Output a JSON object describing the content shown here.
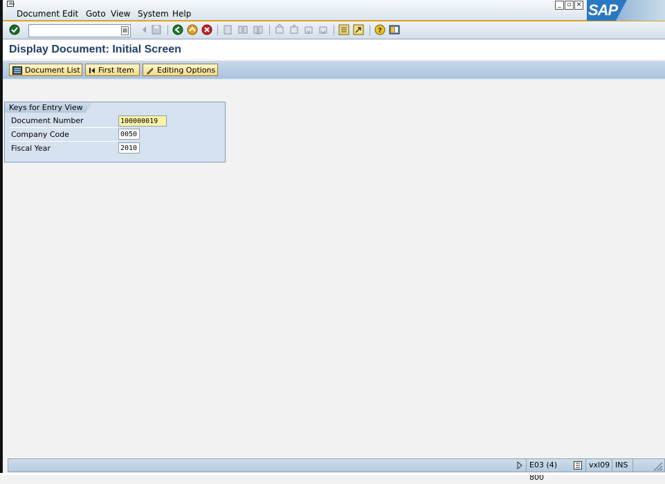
{
  "menu": {
    "items": [
      "Document",
      "Edit",
      "Goto",
      "View",
      "System",
      "Help"
    ]
  },
  "logo": {
    "text": "SAP"
  },
  "toolbar": {
    "command_value": ""
  },
  "title": "Display Document: Initial Screen",
  "app_toolbar": {
    "document_list": "Document List",
    "first_item": "First Item",
    "editing_options": "Editing Options"
  },
  "group": {
    "title": "Keys for Entry View",
    "fields": [
      {
        "label": "Document Number",
        "value": "100000019"
      },
      {
        "label": "Company Code",
        "value": "0050"
      },
      {
        "label": "Fiscal Year",
        "value": "2010"
      }
    ]
  },
  "status": {
    "system": "E03 (4) 800",
    "server": "vxl09",
    "mode": "INS"
  },
  "colors": {
    "accent": "#e0a020",
    "title": "#1f3e66",
    "focus_field": "#fdf3a6"
  }
}
